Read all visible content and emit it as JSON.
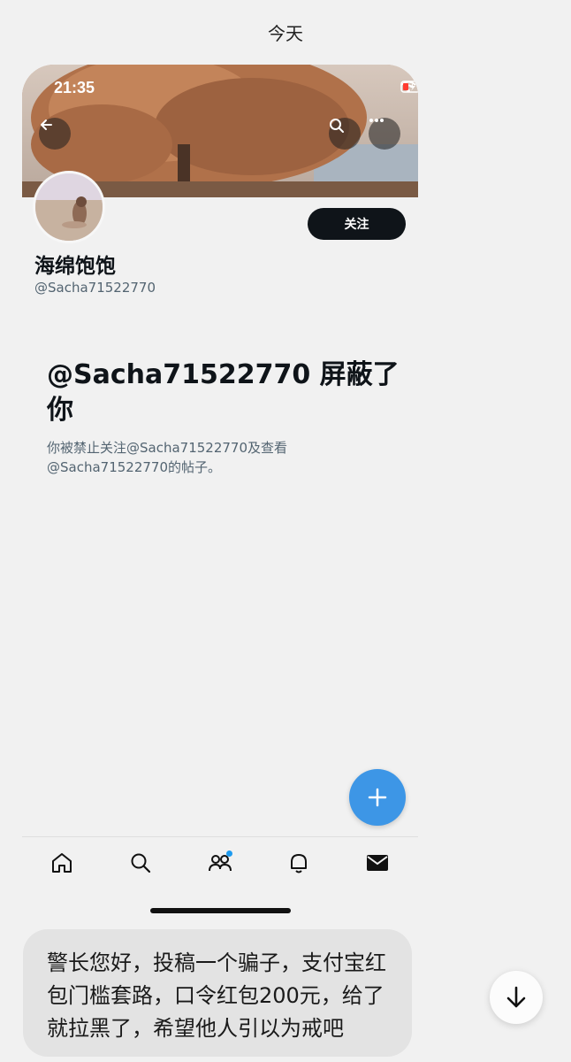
{
  "chat": {
    "day_label": "今天",
    "message": "警长您好，投稿一个骗子，支付宝红包门槛套路，口令红包200元，给了就拉黑了，希望他人引以为戒吧"
  },
  "screenshot": {
    "status_bar": {
      "time": "21:35"
    },
    "profile": {
      "display_name": "海绵饱饱",
      "handle": "@Sacha71522770",
      "follow_label": "关注"
    },
    "blocked": {
      "title": "@Sacha71522770 屏蔽了你",
      "description": "你被禁止关注@Sacha71522770及查看@Sacha71522770的帖子。"
    },
    "tabbar": {
      "items": [
        "home-icon",
        "search-icon",
        "communities-icon",
        "notifications-icon",
        "messages-icon"
      ]
    }
  },
  "colors": {
    "fab": "#3d96e6",
    "follow_button": "#0f1419",
    "badge_dot": "#1d9bf0",
    "bubble": "#e3e3e3"
  }
}
